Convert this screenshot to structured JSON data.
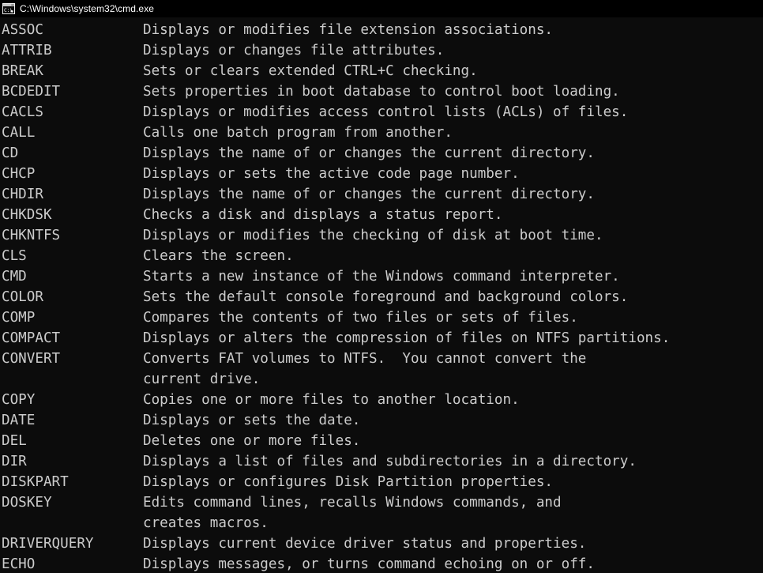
{
  "window": {
    "title": "C:\\Windows\\system32\\cmd.exe",
    "icon": "cmd-console-icon",
    "titlebar_bg": "#000000",
    "console_bg": "#0c0c0c",
    "console_fg": "#cccccc"
  },
  "console": {
    "rows": [
      {
        "command": "ASSOC",
        "description": "Displays or modifies file extension associations."
      },
      {
        "command": "ATTRIB",
        "description": "Displays or changes file attributes."
      },
      {
        "command": "BREAK",
        "description": "Sets or clears extended CTRL+C checking."
      },
      {
        "command": "BCDEDIT",
        "description": "Sets properties in boot database to control boot loading."
      },
      {
        "command": "CACLS",
        "description": "Displays or modifies access control lists (ACLs) of files."
      },
      {
        "command": "CALL",
        "description": "Calls one batch program from another."
      },
      {
        "command": "CD",
        "description": "Displays the name of or changes the current directory."
      },
      {
        "command": "CHCP",
        "description": "Displays or sets the active code page number."
      },
      {
        "command": "CHDIR",
        "description": "Displays the name of or changes the current directory."
      },
      {
        "command": "CHKDSK",
        "description": "Checks a disk and displays a status report."
      },
      {
        "command": "CHKNTFS",
        "description": "Displays or modifies the checking of disk at boot time."
      },
      {
        "command": "CLS",
        "description": "Clears the screen."
      },
      {
        "command": "CMD",
        "description": "Starts a new instance of the Windows command interpreter."
      },
      {
        "command": "COLOR",
        "description": "Sets the default console foreground and background colors."
      },
      {
        "command": "COMP",
        "description": "Compares the contents of two files or sets of files."
      },
      {
        "command": "COMPACT",
        "description": "Displays or alters the compression of files on NTFS partitions."
      },
      {
        "command": "CONVERT",
        "description": "Converts FAT volumes to NTFS.  You cannot convert the",
        "continuation": "current drive."
      },
      {
        "command": "COPY",
        "description": "Copies one or more files to another location."
      },
      {
        "command": "DATE",
        "description": "Displays or sets the date."
      },
      {
        "command": "DEL",
        "description": "Deletes one or more files."
      },
      {
        "command": "DIR",
        "description": "Displays a list of files and subdirectories in a directory."
      },
      {
        "command": "DISKPART",
        "description": "Displays or configures Disk Partition properties."
      },
      {
        "command": "DOSKEY",
        "description": "Edits command lines, recalls Windows commands, and",
        "continuation": "creates macros."
      },
      {
        "command": "DRIVERQUERY",
        "description": "Displays current device driver status and properties."
      },
      {
        "command": "ECHO",
        "description": "Displays messages, or turns command echoing on or off."
      }
    ]
  }
}
